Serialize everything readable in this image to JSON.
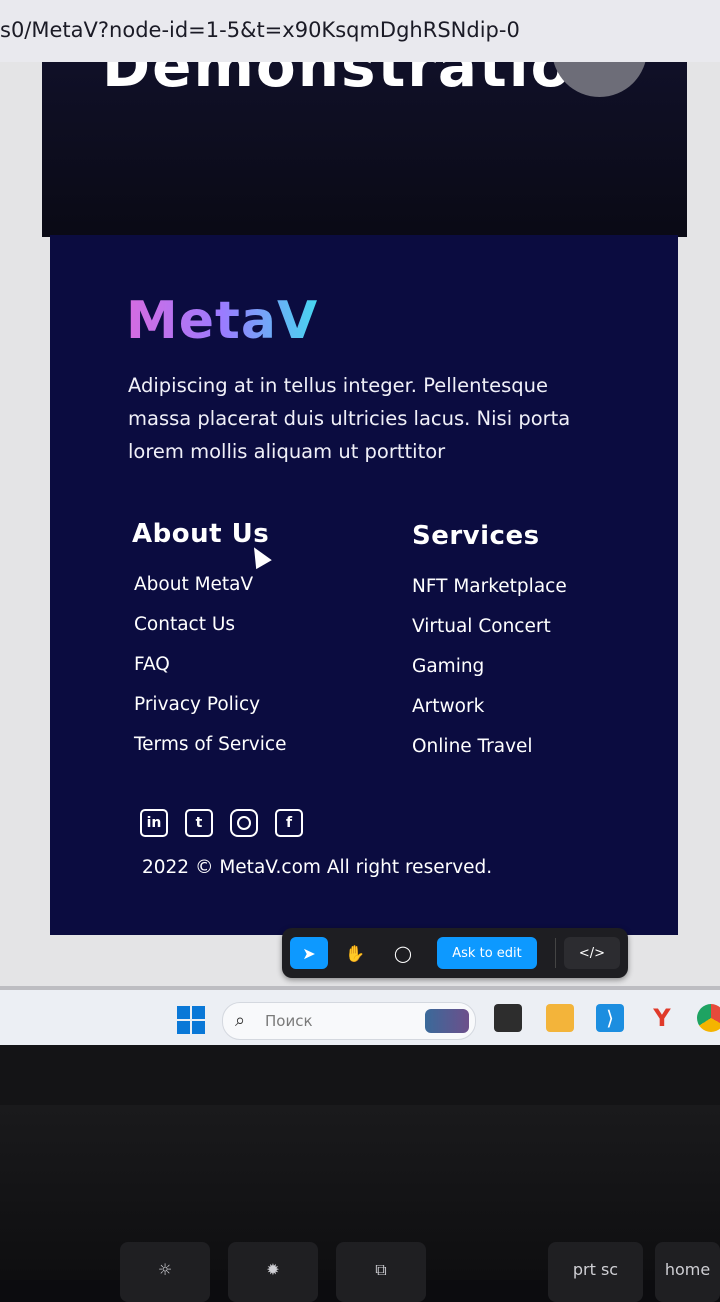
{
  "browser": {
    "url": "s0/MetaV?node-id=1-5&t=x90KsqmDghRSNdip-0"
  },
  "hero": {
    "title": "Demonstration"
  },
  "footer": {
    "brand": "MetaV",
    "description": "Adipiscing at in tellus integer. Pellentesque massa placerat duis ultricies lacus. Nisi porta lorem mollis aliquam ut porttitor",
    "about": {
      "heading": "About Us",
      "links": [
        "About MetaV",
        "Contact Us",
        "FAQ",
        "Privacy Policy",
        "Terms of Service"
      ]
    },
    "services": {
      "heading": "Services",
      "links": [
        "NFT Marketplace",
        "Virtual Concert",
        "Gaming",
        "Artwork",
        "Online Travel"
      ]
    },
    "social": {
      "linkedin": "in",
      "twitter": "t",
      "facebook": "f"
    },
    "copyright": "2022 © MetaV.com All right reserved."
  },
  "toolbar": {
    "move": "➤",
    "hand": "✋",
    "comment": "◯",
    "ask_label": "Ask to edit",
    "code": "</>"
  },
  "taskbar": {
    "search_placeholder": "Поиск",
    "search_glyph": "⌕",
    "vscode_glyph": "⟩",
    "yandex_glyph": "Y"
  },
  "keyboard": {
    "k1": "☼",
    "k2": "✹",
    "k3": "⧉",
    "k4": "prt sc",
    "k5": "home"
  }
}
